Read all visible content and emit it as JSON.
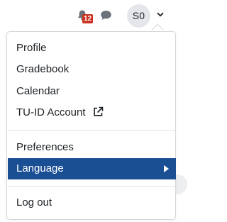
{
  "navbar": {
    "notifications_icon": "bell-icon",
    "notification_count": "12",
    "messages_icon": "chat-bubble-icon",
    "user_initials": "S0",
    "menu_toggle_icon": "chevron-down-icon"
  },
  "user_menu": {
    "items": [
      {
        "label": "Profile"
      },
      {
        "label": "Gradebook"
      },
      {
        "label": "Calendar"
      },
      {
        "label": "TU-ID Account",
        "icon": "external-link-icon"
      },
      {
        "label": "Preferences"
      },
      {
        "label": "Language",
        "submenu_icon": "caret-right-icon",
        "active": true
      },
      {
        "label": "Log out"
      }
    ]
  },
  "colors": {
    "active_item_bg": "#1b4f93",
    "badge_bg": "#ca3120",
    "avatar_bg": "#e4e6e9"
  }
}
